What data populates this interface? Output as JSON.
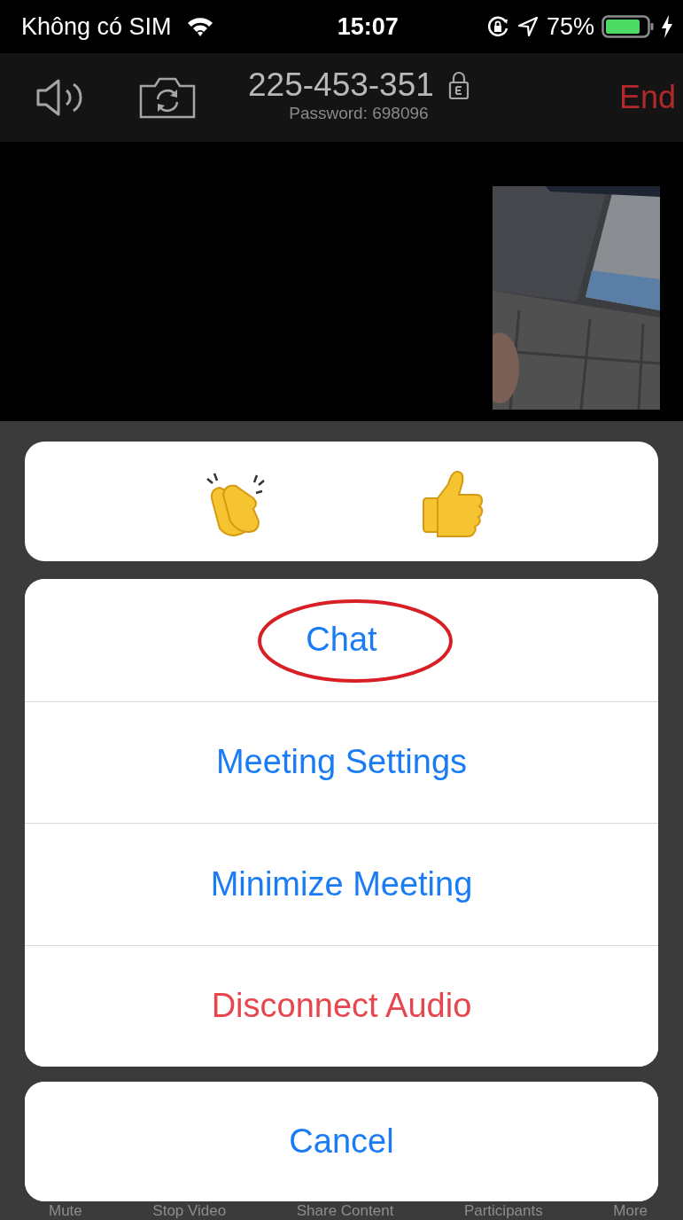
{
  "status_bar": {
    "carrier": "Không có SIM",
    "time": "15:07",
    "battery": "75%"
  },
  "header": {
    "meeting_id": "225-453-351",
    "password": "Password: 698096",
    "end_button": "End"
  },
  "reactions": [
    {
      "kind": "clap"
    },
    {
      "kind": "thumbs_up"
    }
  ],
  "menu": [
    {
      "label": "Chat",
      "kind": "normal",
      "circled": true
    },
    {
      "label": "Meeting Settings",
      "kind": "normal",
      "circled": false
    },
    {
      "label": "Minimize Meeting",
      "kind": "normal",
      "circled": false
    },
    {
      "label": "Disconnect Audio",
      "kind": "destructive",
      "circled": false
    }
  ],
  "cancel": "Cancel",
  "toolbar": [
    "Mute",
    "Stop Video",
    "Share Content",
    "Participants",
    "More"
  ]
}
